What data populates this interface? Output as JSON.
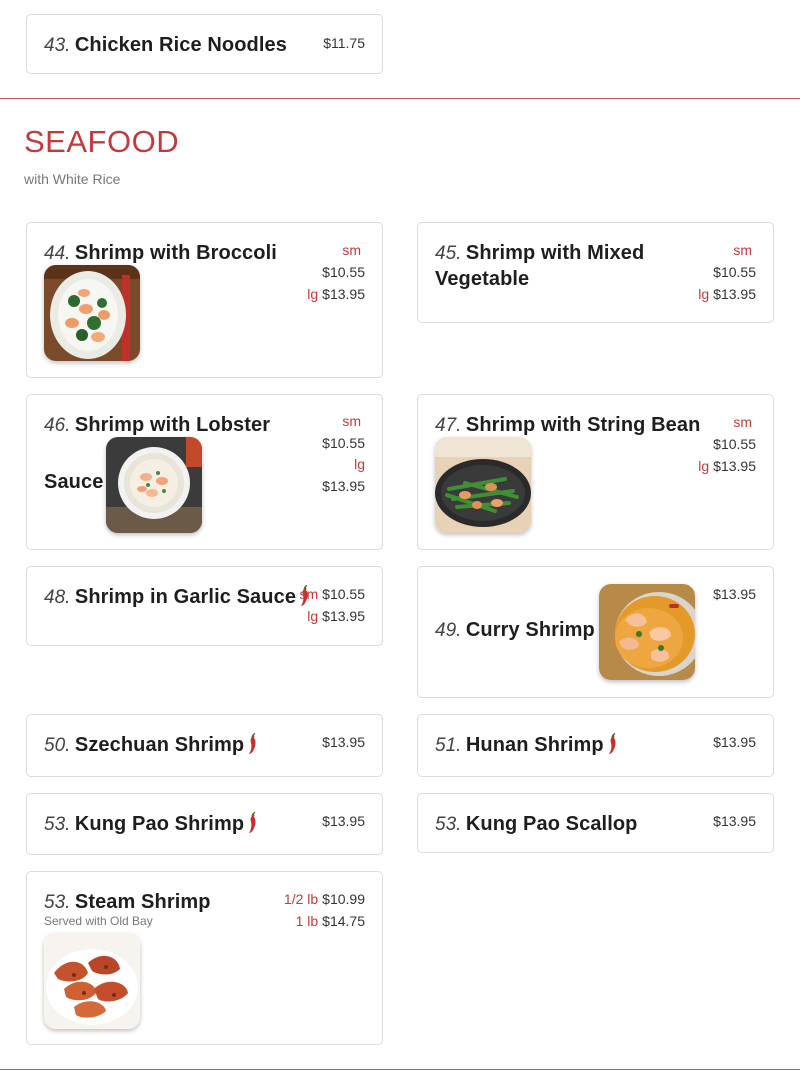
{
  "section": {
    "title": "SEAFOOD",
    "subtitle": "with White Rice"
  },
  "items": {
    "i43": {
      "num": "43.",
      "name": "Chicken Rice Noodles",
      "price": "$11.75"
    },
    "i44": {
      "num": "44.",
      "name": "Shrimp with Broccoli",
      "sm_label": "sm",
      "sm": "$10.55",
      "lg_label": "lg",
      "lg": "$13.95"
    },
    "i45": {
      "num": "45.",
      "name1": "Shrimp with Mixed",
      "name2": "Vegetable",
      "sm_label": "sm",
      "sm": "$10.55",
      "lg_label": "lg",
      "lg": "$13.95"
    },
    "i46": {
      "num": "46.",
      "name1": "Shrimp with Lobster",
      "name2": "Sauce",
      "sm_label": "sm",
      "sm": "$10.55",
      "lg_label": "lg",
      "lg": "$13.95"
    },
    "i47": {
      "num": "47.",
      "name": "Shrimp with String Bean",
      "sm_label": "sm",
      "sm": "$10.55",
      "lg_label": "lg",
      "lg": "$13.95"
    },
    "i48": {
      "num": "48.",
      "name": "Shrimp in Garlic Sauce",
      "sm_label": "sm",
      "sm": "$10.55",
      "lg_label": "lg",
      "lg": "$13.95"
    },
    "i49": {
      "num": "49.",
      "name": "Curry Shrimp",
      "price": "$13.95"
    },
    "i50": {
      "num": "50.",
      "name": "Szechuan Shrimp",
      "price": "$13.95"
    },
    "i51": {
      "num": "51.",
      "name": "Hunan Shrimp",
      "price": "$13.95"
    },
    "i53a": {
      "num": "53.",
      "name": "Kung Pao Shrimp",
      "price": "$13.95"
    },
    "i53b": {
      "num": "53.",
      "name": "Kung Pao Scallop",
      "price": "$13.95"
    },
    "i53c": {
      "num": "53.",
      "name": "Steam Shrimp",
      "desc": "Served with Old Bay",
      "half_label": "1/2 lb",
      "half": "$10.99",
      "full_label": "1 lb",
      "full": "$14.75"
    }
  },
  "icons": {
    "spicy": "chili-pepper-icon"
  },
  "colors": {
    "accent": "#c4393b",
    "divider": "#b65b58",
    "border": "#dcdcdc"
  }
}
